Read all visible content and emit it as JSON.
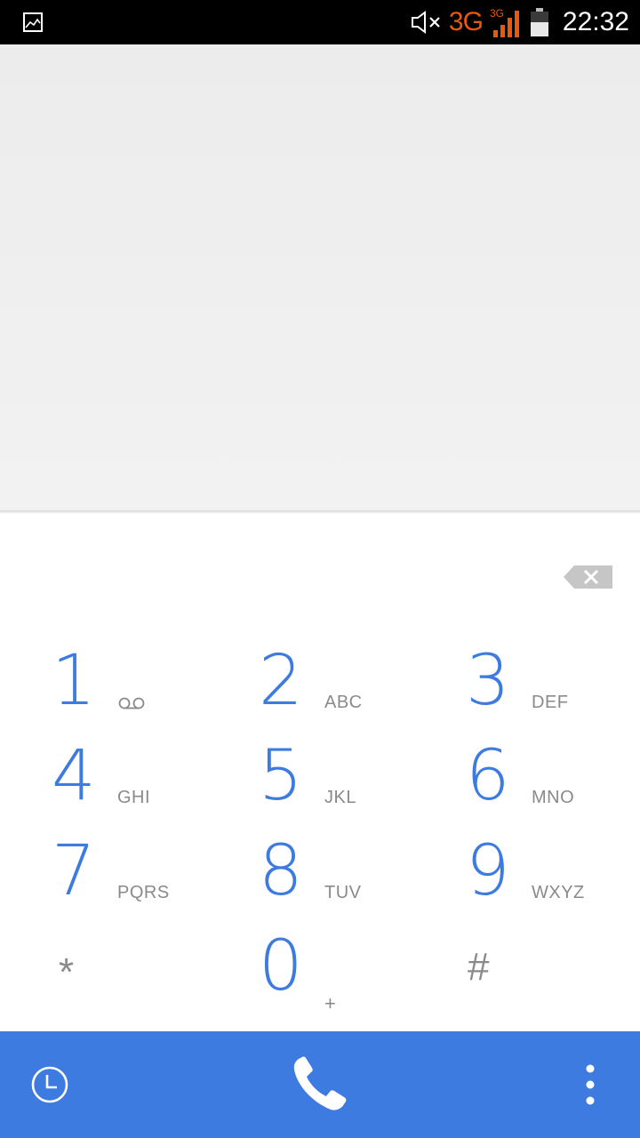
{
  "status_bar": {
    "network": "3G",
    "network_small": "3G",
    "time": "22:32",
    "icons": [
      "gallery-icon",
      "mute-icon",
      "signal-icon",
      "battery-icon"
    ],
    "network_color": "#e8590c"
  },
  "dialer": {
    "digits_value": "",
    "accent_color": "#3d7be0",
    "keys": [
      {
        "digit": "1",
        "letters": "",
        "voicemail": true
      },
      {
        "digit": "2",
        "letters": "ABC"
      },
      {
        "digit": "3",
        "letters": "DEF"
      },
      {
        "digit": "4",
        "letters": "GHI"
      },
      {
        "digit": "5",
        "letters": "JKL"
      },
      {
        "digit": "6",
        "letters": "MNO"
      },
      {
        "digit": "7",
        "letters": "PQRS"
      },
      {
        "digit": "8",
        "letters": "TUV"
      },
      {
        "digit": "9",
        "letters": "WXYZ"
      },
      {
        "symbol": "*"
      },
      {
        "digit": "0",
        "letters": "+"
      },
      {
        "symbol": "#"
      }
    ]
  },
  "action_bar": {
    "icons": [
      "history-icon",
      "phone-icon",
      "overflow-menu-icon"
    ]
  }
}
